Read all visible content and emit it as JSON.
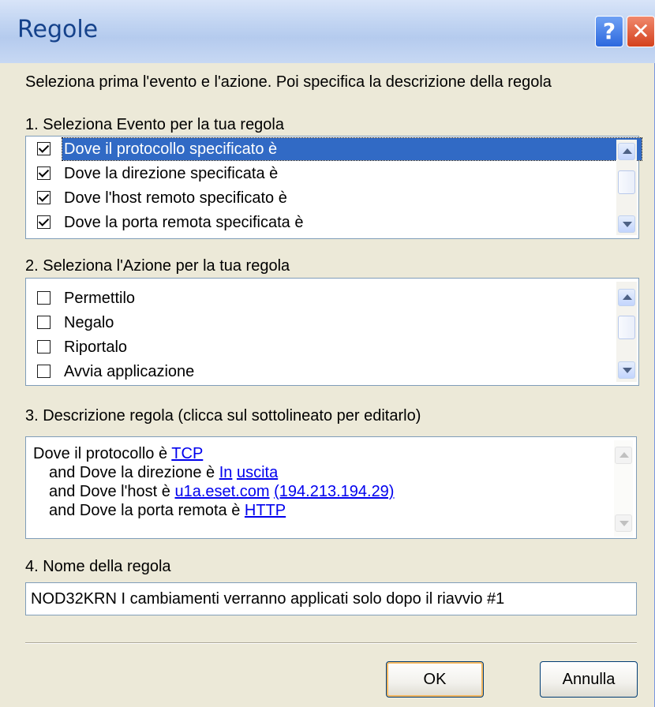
{
  "window": {
    "title": "Regole",
    "help_glyph": "?",
    "close_glyph": "✕"
  },
  "instructions": "Seleziona prima l'evento e l'azione. Poi specifica la descrizione della regola",
  "section1": {
    "label": "1. Seleziona Evento per la tua regola",
    "items": [
      {
        "label": "Dove il protocollo specificato è",
        "checked": true,
        "selected": true
      },
      {
        "label": "Dove la direzione specificata è",
        "checked": true,
        "selected": false
      },
      {
        "label": "Dove l'host remoto specificato è",
        "checked": true,
        "selected": false
      },
      {
        "label": "Dove la porta remota specificata è",
        "checked": true,
        "selected": false
      }
    ]
  },
  "section2": {
    "label": "2. Seleziona l'Azione per la tua regola",
    "items": [
      {
        "label": "Permettilo",
        "checked": false
      },
      {
        "label": "Negalo",
        "checked": false
      },
      {
        "label": "Riportalo",
        "checked": false
      },
      {
        "label": "Avvia applicazione",
        "checked": false
      }
    ]
  },
  "section3": {
    "label": "3. Descrizione regola (clicca sul sottolineato per editarlo)",
    "lines": [
      {
        "prefix": "Dove il protocollo è ",
        "links": [
          "TCP"
        ]
      },
      {
        "prefix": "and Dove la direzione è ",
        "links": [
          "In",
          "uscita"
        ]
      },
      {
        "prefix": "and Dove l'host è ",
        "links": [
          "u1a.eset.com",
          "(194.213.194.29)"
        ]
      },
      {
        "prefix": "and Dove la porta remota è ",
        "links": [
          "HTTP"
        ]
      }
    ]
  },
  "section4": {
    "label": "4. Nome della regola",
    "value": "NOD32KRN I cambiamenti verranno applicati solo dopo il riavvio #1"
  },
  "buttons": {
    "ok": "OK",
    "cancel": "Annulla"
  }
}
